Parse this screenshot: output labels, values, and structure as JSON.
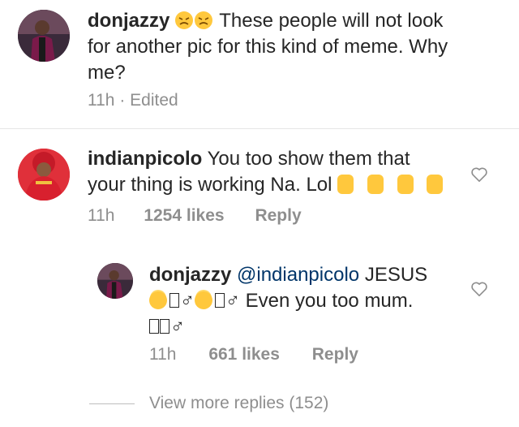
{
  "comments": [
    {
      "username": "donjazzy",
      "text": "These people will not look for another pic for this kind of meme. Why me?",
      "text_line1": "These people will not look",
      "text_line2": "for another pic for this kind of meme. Why",
      "text_line3": "me?",
      "emojis": [
        "persevering-face-icon",
        "persevering-face-icon"
      ],
      "time": "11h",
      "edited": "Edited"
    },
    {
      "username": "indianpicolo",
      "text": "You too show them that your thing is working Na. Lol",
      "text_line1": "You too show them that",
      "text_line2": "your thing is working Na. Lol",
      "emojis": [
        "person-bowing-icon",
        "person-bowing-icon",
        "person-bowing-icon",
        "person-bowing-icon"
      ],
      "time": "11h",
      "likes": "1254 likes",
      "reply": "Reply"
    }
  ],
  "reply": {
    "username": "donjazzy",
    "mention": "@indianpicolo",
    "word1": "JESUS",
    "glyph": "♂",
    "text": "Even you too mum.",
    "time": "11h",
    "likes": "661 likes",
    "reply": "Reply"
  },
  "view_more": "View more replies (152)",
  "colors": {
    "text": "#262626",
    "meta": "#8e8e8e",
    "mention": "#003569",
    "divider": "#e6e6e6",
    "emoji_yellow": "#ffc83d"
  }
}
